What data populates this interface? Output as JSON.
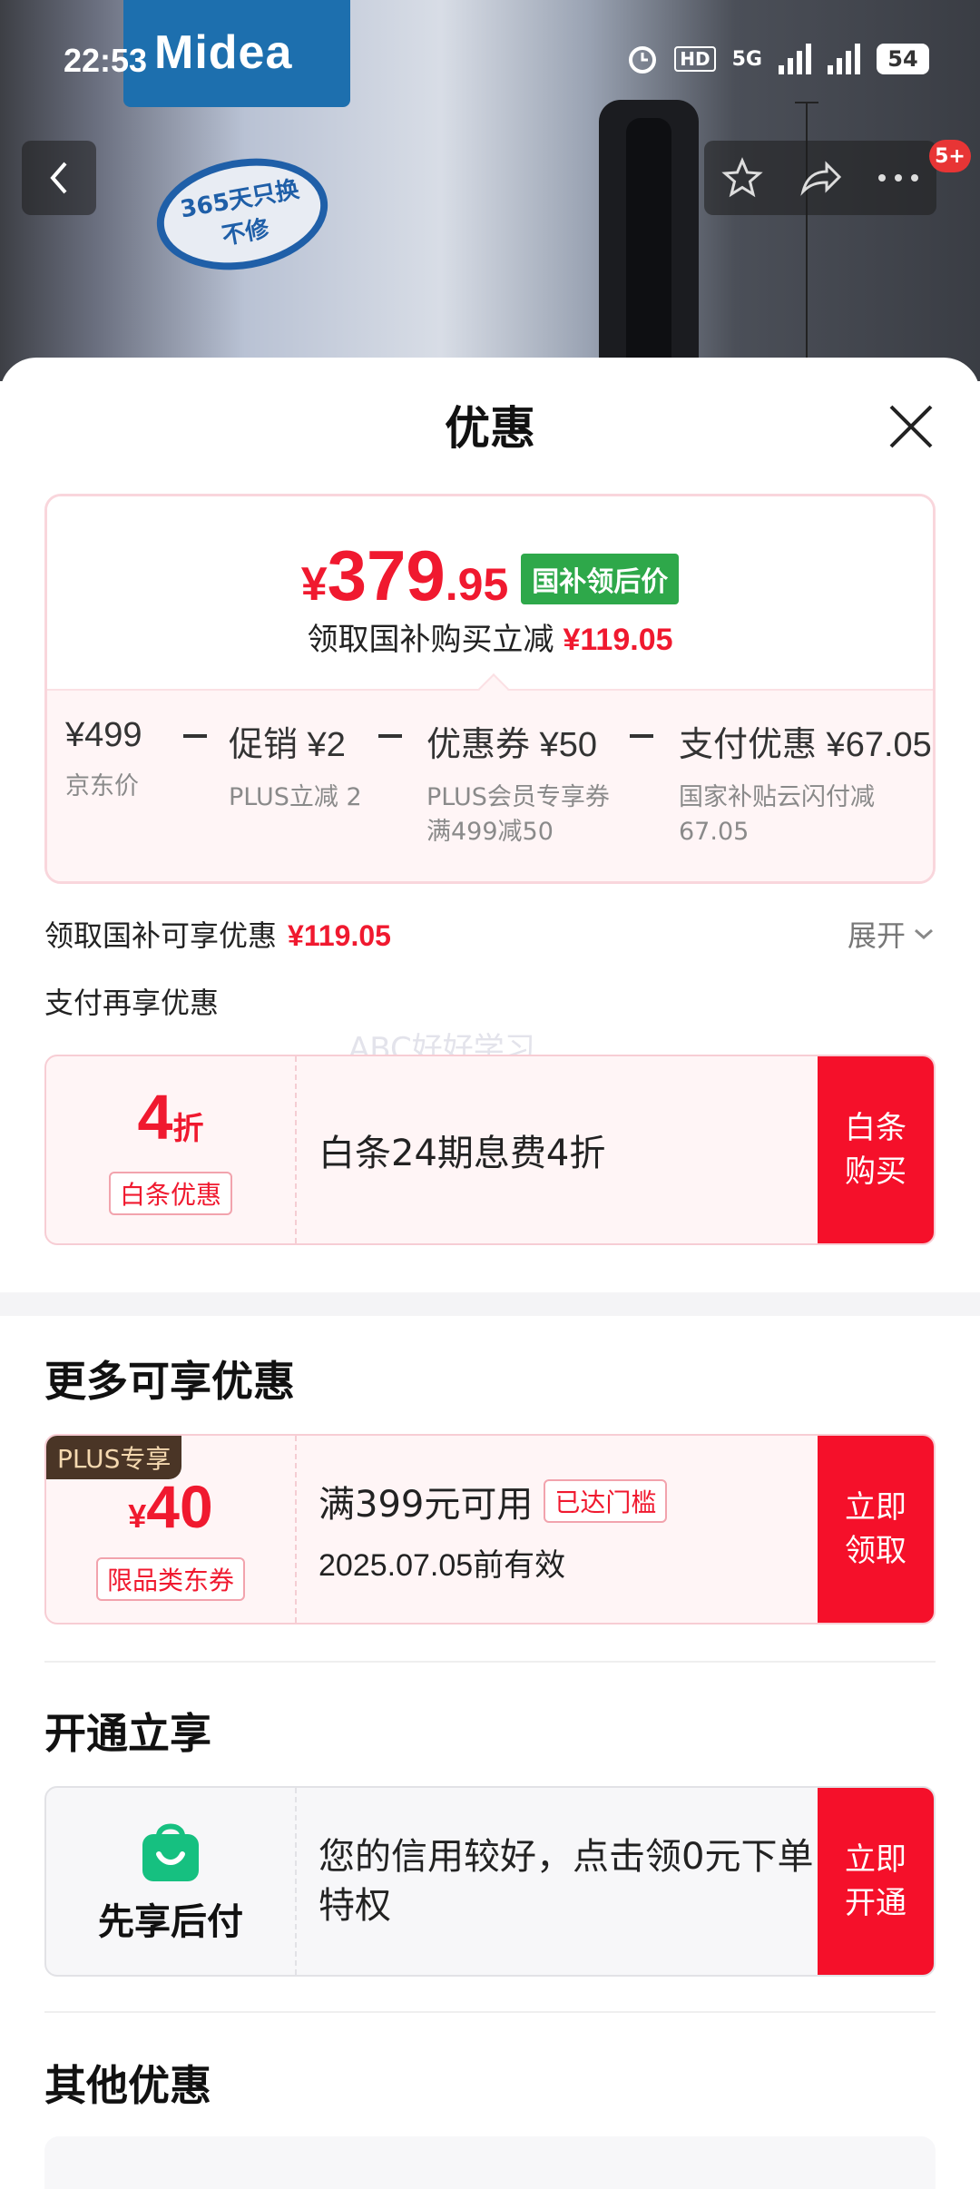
{
  "status_bar": {
    "time": "22:53",
    "network": "5G",
    "battery": "54"
  },
  "product": {
    "brand": "Midea",
    "badge": "365天只换不修"
  },
  "nav": {
    "badge_count": "5+"
  },
  "sheet": {
    "title": "优惠",
    "price": {
      "currency": "¥",
      "integer": "379",
      "decimal": ".95",
      "tag": "国补领后价",
      "sub_label": "领取国补购买立减",
      "sub_amount": "¥119.05"
    },
    "breakdown": [
      {
        "value": "¥499",
        "label": "京东价"
      },
      {
        "value": "促销 ¥2",
        "label": "PLUS立减 2"
      },
      {
        "value": "优惠券 ¥50",
        "label": "PLUS会员专享券满499减50"
      },
      {
        "value": "支付优惠 ¥67.05",
        "label": "国家补贴云闪付减 67.05"
      }
    ],
    "subsidy_row": {
      "label": "领取国补可享优惠",
      "amount": "¥119.05",
      "expand": "展开"
    },
    "pay_more": "支付再享优惠",
    "watermark": "ABC好好学习",
    "baitiao": {
      "discount": "4",
      "discount_unit": "折",
      "tag": "白条优惠",
      "title": "白条24期息费4折",
      "action": "白条购买"
    },
    "more_section": {
      "title": "更多可享优惠",
      "coupon": {
        "plus_tag": "PLUS专享",
        "currency": "¥",
        "amount": "40",
        "tag": "限品类东券",
        "condition": "满399元可用",
        "reached": "已达门槛",
        "valid": "2025.07.05前有效",
        "action": "立即领取"
      }
    },
    "open_section": {
      "title": "开通立享",
      "label": "先享后付",
      "text": "您的信用较好，点击领0元下单特权",
      "action": "立即开通"
    },
    "other_section": {
      "title": "其他优惠"
    }
  },
  "colors": {
    "accent_red": "#f0192f",
    "action_red": "#f5102a",
    "green_tag": "#2ea84a",
    "plus_brown": "#4a3526"
  }
}
